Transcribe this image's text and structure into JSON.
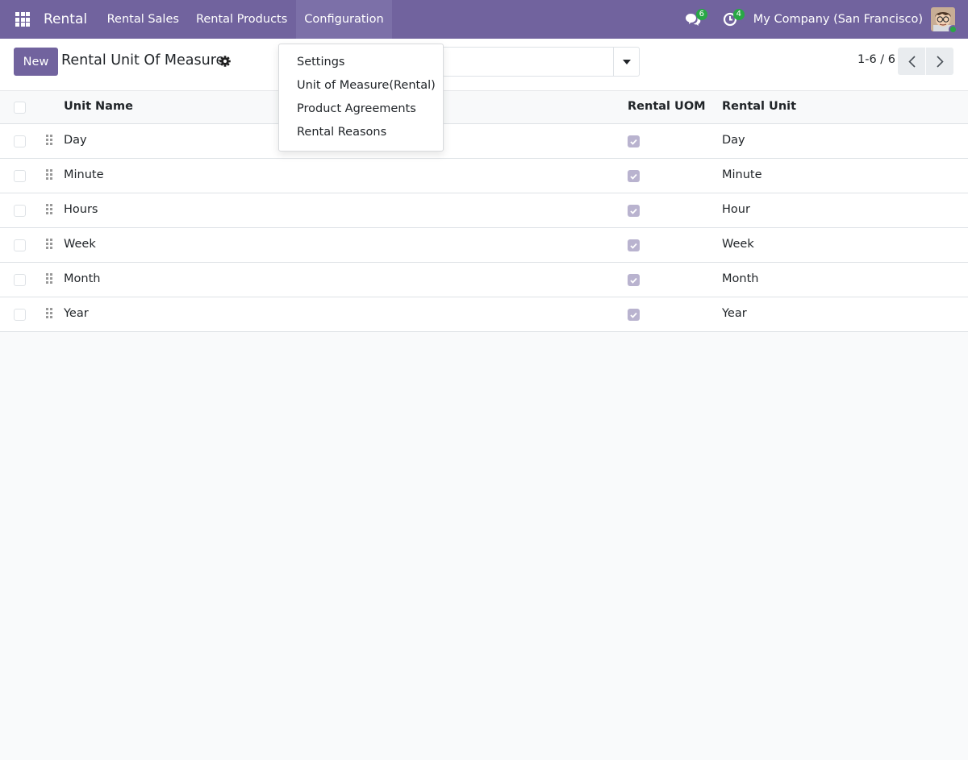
{
  "navbar": {
    "brand": "Rental",
    "menu": [
      "Rental Sales",
      "Rental Products",
      "Configuration"
    ],
    "messages_count": "6",
    "activities_count": "4",
    "company": "My Company (San Francisco)"
  },
  "control_panel": {
    "new_label": "New",
    "title": "Rental Unit Of Measure",
    "pager": "1-6 / 6"
  },
  "config_menu": {
    "items": [
      "Settings",
      "Unit of Measure(Rental)",
      "Product Agreements",
      "Rental Reasons"
    ]
  },
  "table": {
    "columns": [
      "Unit Name",
      "Rental UOM",
      "Rental Unit"
    ],
    "rows": [
      {
        "name": "Day",
        "rental_uom": true,
        "unit": "Day"
      },
      {
        "name": "Minute",
        "rental_uom": true,
        "unit": "Minute"
      },
      {
        "name": "Hours",
        "rental_uom": true,
        "unit": "Hour"
      },
      {
        "name": "Week",
        "rental_uom": true,
        "unit": "Week"
      },
      {
        "name": "Month",
        "rental_uom": true,
        "unit": "Month"
      },
      {
        "name": "Year",
        "rental_uom": true,
        "unit": "Year"
      }
    ]
  },
  "colors": {
    "brand": "#71639e",
    "badge": "#28a745",
    "checked": "#b9b3cf"
  }
}
